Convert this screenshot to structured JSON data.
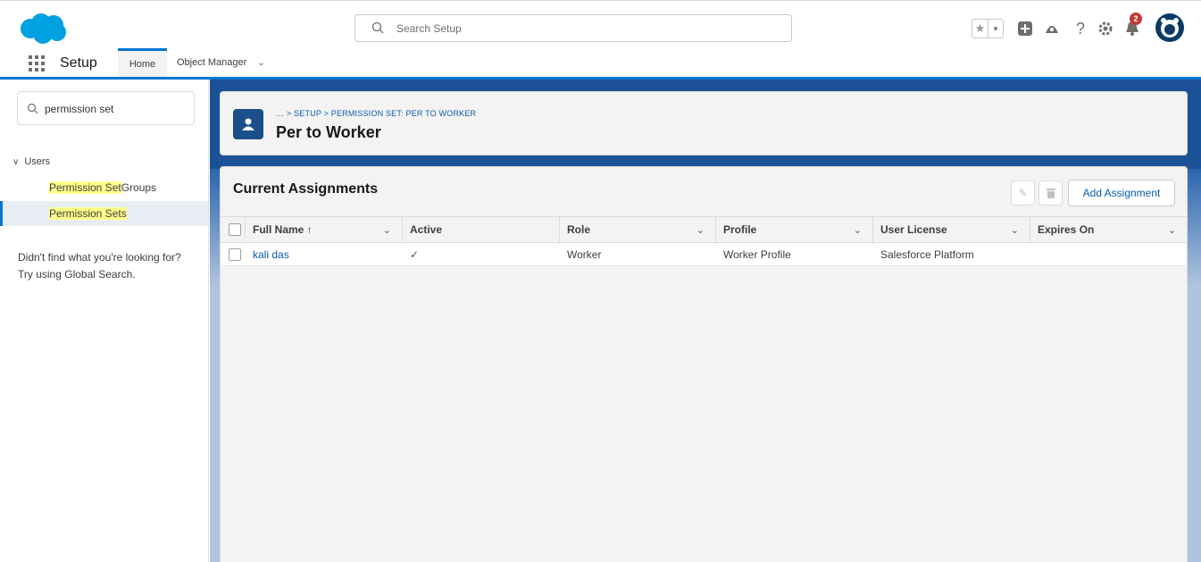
{
  "header": {
    "search_placeholder": "Search Setup",
    "notification_count": "2"
  },
  "nav": {
    "app_name": "Setup",
    "tabs": [
      {
        "label": "Home"
      },
      {
        "label": "Object Manager"
      }
    ]
  },
  "sidebar": {
    "search_value": "permission set",
    "section_label": "Users",
    "items": [
      {
        "hl": "Permission Set",
        "rest": " Groups"
      },
      {
        "hl": "Permission Sets",
        "rest": ""
      }
    ],
    "help_line1": "Didn't find what you're looking for?",
    "help_line2": "Try using Global Search."
  },
  "page": {
    "breadcrumb": "… > SETUP > PERMISSION SET: PER TO WORKER",
    "title": "Per to Worker"
  },
  "assignments": {
    "title": "Current Assignments",
    "add_button": "Add Assignment",
    "columns": [
      "Full Name ↑",
      "Active",
      "Role",
      "Profile",
      "User License",
      "Expires On"
    ],
    "rows": [
      {
        "full_name": "kali das",
        "active": "✓",
        "role": "Worker",
        "profile": "Worker Profile",
        "user_license": "Salesforce Platform",
        "expires_on": ""
      }
    ]
  },
  "colors": {
    "brand_blue": "#0176d3",
    "link_blue": "#0b5cab",
    "highlight": "#ffff8a"
  }
}
